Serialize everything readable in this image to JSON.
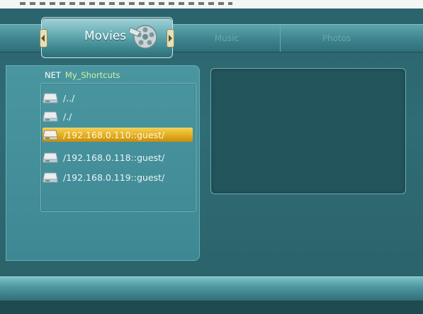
{
  "nav": {
    "active_tab": "Movies",
    "tabs": [
      "Music",
      "Photos"
    ]
  },
  "browser": {
    "source_label": "NET",
    "folder_label": "My_Shortcuts",
    "items": [
      {
        "label": "/../",
        "selected": false,
        "icon": "network-drive-icon"
      },
      {
        "label": "/./",
        "selected": false,
        "icon": "network-drive-icon"
      },
      {
        "label": "/192.168.0.110::guest/",
        "selected": true,
        "icon": "network-drive-icon"
      },
      {
        "label": "/192.168.0.118::guest/",
        "selected": false,
        "icon": "network-drive-icon"
      },
      {
        "label": "/192.168.0.119::guest/",
        "selected": false,
        "icon": "network-drive-icon"
      }
    ]
  },
  "colors": {
    "background": "#2f6a73",
    "highlight": "#e3ad1f",
    "accent_text": "#d4f0a2"
  }
}
